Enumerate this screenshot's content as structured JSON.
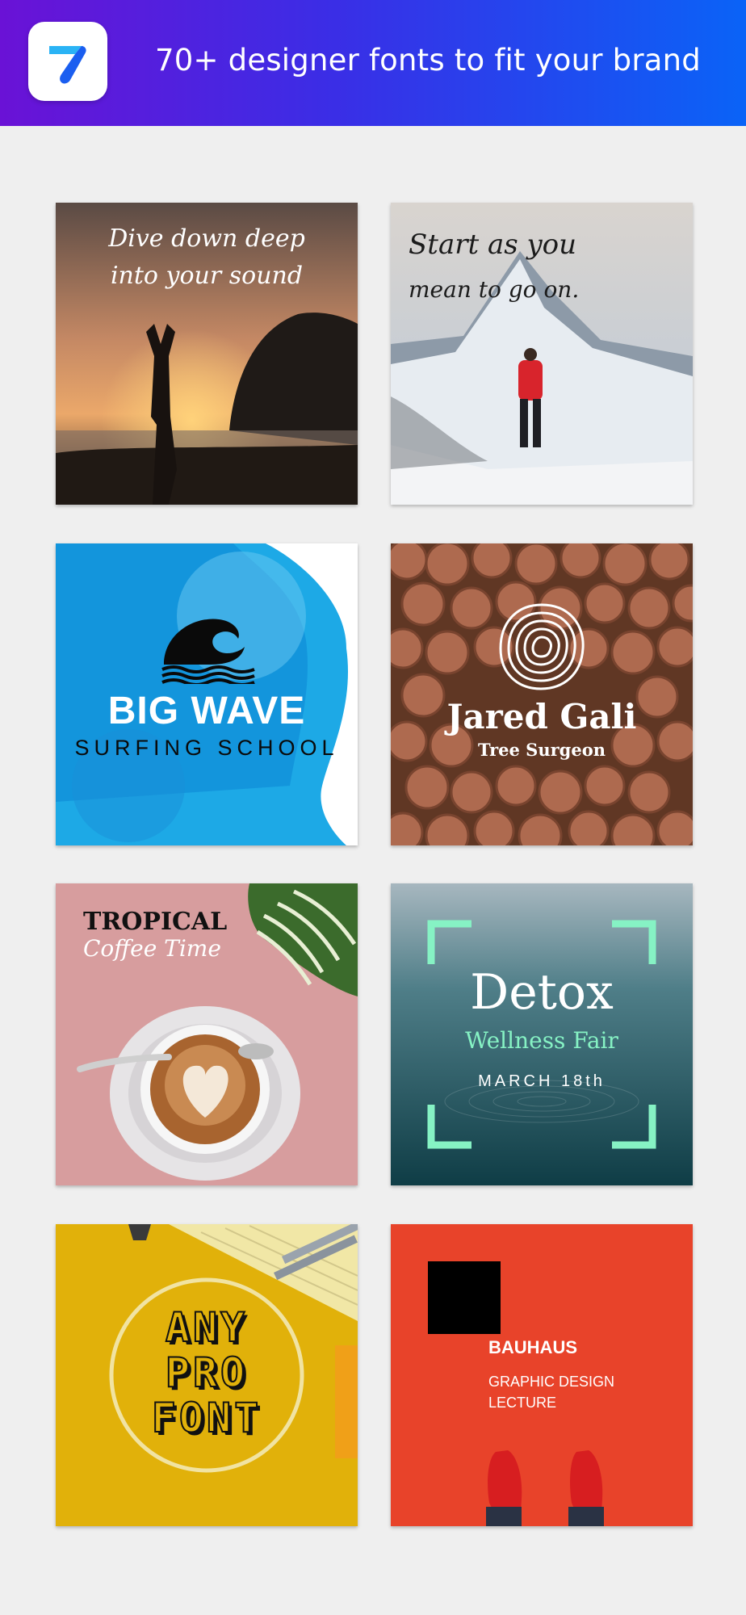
{
  "header": {
    "title": "70+ designer fonts to fit your brand",
    "icon": "app-logo-icon",
    "gradient": [
      "#6a12d6",
      "#0a63f7"
    ]
  },
  "templates": [
    {
      "line1": "Dive down deep",
      "line2": "into your sound",
      "image": "yoga-sunset-photo"
    },
    {
      "line1": "Start as you",
      "line2": "mean to go on.",
      "image": "mountain-hiker-photo"
    },
    {
      "title": "BIG WAVE",
      "subtitle": "SURFING SCHOOL",
      "icon": "wave-icon"
    },
    {
      "title": "Jared Gali",
      "subtitle": "Tree Surgeon",
      "icon": "tree-rings-icon"
    },
    {
      "title": "TROPICAL",
      "subtitle": "Coffee Time",
      "image": "coffee-cup-photo"
    },
    {
      "title": "Detox",
      "subtitle": "Wellness Fair",
      "date": "MARCH 18th",
      "accent": "#86f2c4"
    },
    {
      "line1": "ANY",
      "line2": "PRO",
      "line3": "FONT",
      "image": "yellow-desk-photo"
    },
    {
      "title": "BAUHAUS",
      "line1": "GRAPHIC DESIGN",
      "line2": "LECTURE",
      "accent": "#e8432a"
    }
  ]
}
